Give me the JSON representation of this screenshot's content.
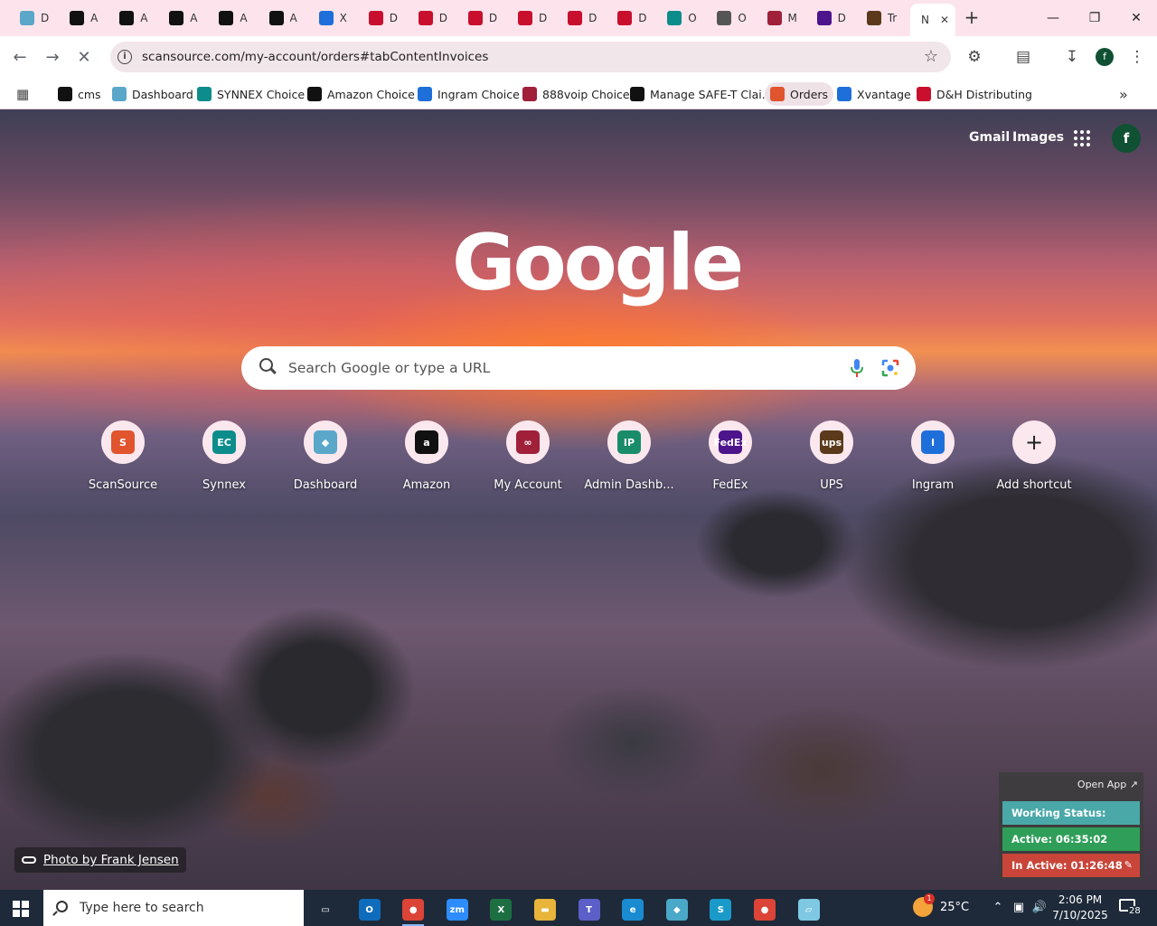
{
  "tabs": [
    {
      "title": "D",
      "icon": "dashboard-icon",
      "color": "#5aa7c9"
    },
    {
      "title": "A",
      "icon": "amazon-icon",
      "color": "#111111"
    },
    {
      "title": "A",
      "icon": "amazon-icon",
      "color": "#111111"
    },
    {
      "title": "A",
      "icon": "amazon-icon",
      "color": "#111111"
    },
    {
      "title": "A",
      "icon": "amazon-icon",
      "color": "#111111"
    },
    {
      "title": "A",
      "icon": "amazon-icon",
      "color": "#111111"
    },
    {
      "title": "X",
      "icon": "xvantage-icon",
      "color": "#1e6fd9"
    },
    {
      "title": "D",
      "icon": "dh-icon",
      "color": "#c8102e"
    },
    {
      "title": "D",
      "icon": "dh-icon",
      "color": "#c8102e"
    },
    {
      "title": "D",
      "icon": "dh-icon",
      "color": "#c8102e"
    },
    {
      "title": "D",
      "icon": "dh-icon",
      "color": "#c8102e"
    },
    {
      "title": "D",
      "icon": "dh-icon",
      "color": "#c8102e"
    },
    {
      "title": "D",
      "icon": "dh-icon",
      "color": "#c8102e"
    },
    {
      "title": "O",
      "icon": "synnex-icon",
      "color": "#0d8c8c"
    },
    {
      "title": "O",
      "icon": "truck-icon",
      "color": "#555555"
    },
    {
      "title": "M",
      "icon": "myaccount-icon",
      "color": "#a0203a"
    },
    {
      "title": "D",
      "icon": "fedex-icon",
      "color": "#4d148c"
    },
    {
      "title": "Tr",
      "icon": "ups-icon",
      "color": "#5a3a1a"
    },
    {
      "title": "N",
      "icon": "",
      "color": "#ffffff",
      "active": true
    }
  ],
  "address_bar": {
    "url": "scansource.com/my-account/orders#tabContentInvoices"
  },
  "bookmarks": [
    {
      "label": "cms",
      "icon": "cms-icon",
      "color": "#111111"
    },
    {
      "label": "Dashboard",
      "icon": "dashboard-icon",
      "color": "#5aa7c9"
    },
    {
      "label": "SYNNEX Choice",
      "icon": "synnex-icon",
      "color": "#0d8c8c"
    },
    {
      "label": "Amazon Choice",
      "icon": "amazon-icon",
      "color": "#111111"
    },
    {
      "label": "Ingram Choice",
      "icon": "ingram-icon",
      "color": "#1e6fd9"
    },
    {
      "label": "888voip Choice",
      "icon": "myaccount-icon",
      "color": "#a0203a"
    },
    {
      "label": "Manage SAFE-T Clai...",
      "icon": "amazon-icon",
      "color": "#111111"
    },
    {
      "label": "Orders",
      "icon": "scansource-icon",
      "color": "#e0542e",
      "active": true
    },
    {
      "label": "Xvantage",
      "icon": "xvantage-icon",
      "color": "#1e6fd9"
    },
    {
      "label": "D&H Distributing",
      "icon": "dh-icon",
      "color": "#c8102e"
    }
  ],
  "ntp": {
    "gmail": "Gmail",
    "images": "Images",
    "avatar_letter": "f",
    "logo": "Google",
    "search_placeholder": "Search Google or type a URL",
    "photo_credit": "Photo by Frank Jensen"
  },
  "shortcuts": [
    {
      "label": "ScanSource",
      "icon": "scansource-icon",
      "color": "#e0542e",
      "glyph": "S"
    },
    {
      "label": "Synnex",
      "icon": "synnex-icon",
      "color": "#0d8c8c",
      "glyph": "EC"
    },
    {
      "label": "Dashboard",
      "icon": "dashboard-icon",
      "color": "#5aa7c9",
      "glyph": "◆"
    },
    {
      "label": "Amazon",
      "icon": "amazon-icon",
      "color": "#111111",
      "glyph": "a"
    },
    {
      "label": "My Account",
      "icon": "myaccount-icon",
      "color": "#a0203a",
      "glyph": "∞"
    },
    {
      "label": "Admin Dashb...",
      "icon": "admin-icon",
      "color": "#1a8c6a",
      "glyph": "IP"
    },
    {
      "label": "FedEx",
      "icon": "fedex-icon",
      "color": "#4d148c",
      "glyph": "FedEx"
    },
    {
      "label": "UPS",
      "icon": "ups-icon",
      "color": "#5a3a1a",
      "glyph": "ups"
    },
    {
      "label": "Ingram",
      "icon": "ingram-icon",
      "color": "#1e6fd9",
      "glyph": "I"
    },
    {
      "label": "Add shortcut",
      "icon": "plus-icon",
      "color": "#fbe8ee",
      "glyph": "+"
    }
  ],
  "status_widget": {
    "open_app": "Open App ↗",
    "working_status": "Working Status: Active",
    "active": "Active: 06:35:02",
    "inactive": "In Active: 01:26:48"
  },
  "taskbar": {
    "search_placeholder": "Type here to search",
    "apps": [
      {
        "icon": "task-view-icon",
        "color": "#1e2a3a",
        "glyph": "▭"
      },
      {
        "icon": "outlook-icon",
        "color": "#0f6cbd",
        "glyph": "O"
      },
      {
        "icon": "chrome-icon",
        "color": "#db4437",
        "glyph": "●",
        "running": true
      },
      {
        "icon": "zoom-icon",
        "color": "#2d8cff",
        "glyph": "zm"
      },
      {
        "icon": "excel-icon",
        "color": "#1d6f42",
        "glyph": "X"
      },
      {
        "icon": "file-explorer-icon",
        "color": "#e8b43a",
        "glyph": "▬"
      },
      {
        "icon": "teams-icon",
        "color": "#5b5fc7",
        "glyph": "T"
      },
      {
        "icon": "edge-icon",
        "color": "#1a8bd0",
        "glyph": "e"
      },
      {
        "icon": "app-diamond-icon",
        "color": "#4aa8c8",
        "glyph": "◆"
      },
      {
        "icon": "app-s-icon",
        "color": "#1a9ac9",
        "glyph": "S"
      },
      {
        "icon": "chrome-profile-icon",
        "color": "#db4437",
        "glyph": "●"
      },
      {
        "icon": "notepad-icon",
        "color": "#7ec8e3",
        "glyph": "▱"
      }
    ],
    "weather_temp": "25°C",
    "weather_badge": "1",
    "time": "2:06 PM",
    "date": "7/10/2025",
    "notification_count": "28"
  }
}
